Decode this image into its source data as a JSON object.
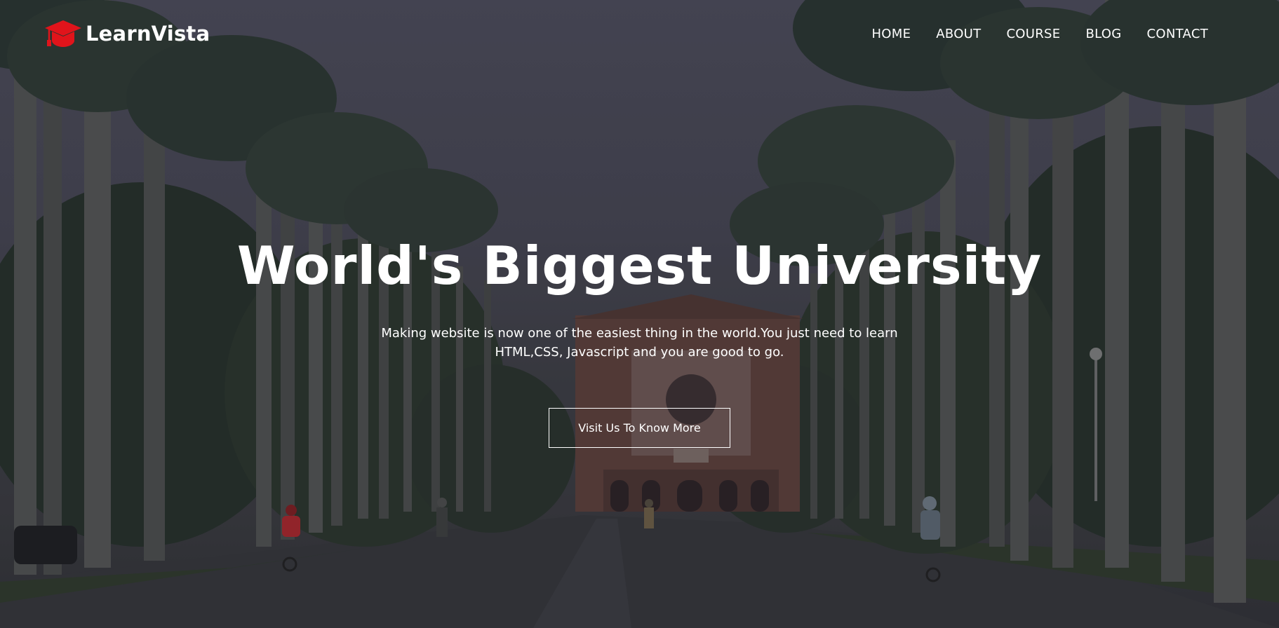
{
  "brand": {
    "name": "LearnVista",
    "icon": "graduation-cap-icon",
    "accent_color": "#e0141b"
  },
  "nav": {
    "items": [
      {
        "label": "HOME"
      },
      {
        "label": "ABOUT"
      },
      {
        "label": "COURSE"
      },
      {
        "label": "BLOG"
      },
      {
        "label": "CONTACT"
      }
    ]
  },
  "hero": {
    "title": "World's Biggest University",
    "subtitle": "Making website is now one of the easiest thing in the world.You just need to learn HTML,CSS, Javascript and you are good to go.",
    "cta_label": "Visit Us To Know More"
  }
}
